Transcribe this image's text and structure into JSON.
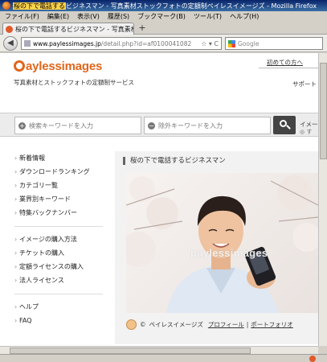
{
  "window": {
    "title_prefix": "桜の下で電話する",
    "title_rest": "ビジネスマン - 写真素材ストックフォトの定額制ペイレスイメージズ - Mozilla Firefox"
  },
  "menu": [
    "ファイル(F)",
    "編集(E)",
    "表示(V)",
    "履歴(S)",
    "ブックマーク(B)",
    "ツール(T)",
    "ヘルプ(H)"
  ],
  "tab": {
    "label": "桜の下で電話するビジネスマン - 写真素材ストックフ..."
  },
  "nav": {
    "url_domain": "www.paylessimages.jp",
    "url_path": "/detail.php?id=af0100041082",
    "search_placeholder": "Google",
    "url_icons": "☆ ▾ C"
  },
  "header": {
    "logo_text": "aylessimages",
    "tagline": "写真素材とストックフォトの定額制サービス",
    "first_time_link": "初めての方へ",
    "support_label": "サポート"
  },
  "search": {
    "keyword_placeholder": "検索キーワードを入力",
    "exclude_placeholder": "除外キーワードを入力",
    "image_search_label": "イメー",
    "image_search_sub": "◎ す"
  },
  "sidebar": {
    "group1": [
      "新着情報",
      "ダウンロードランキング",
      "カテゴリ一覧",
      "業界別キーワード",
      "特集バックナンバー"
    ],
    "group2": [
      "イメージの購入方法",
      "チケットの購入",
      "定額ライセンスの購入",
      "法人ライセンス"
    ],
    "group3": [
      "ヘルプ",
      "FAQ"
    ]
  },
  "content": {
    "title": "桜の下で電話するビジネスマン",
    "watermark": "paylessimages",
    "credit": {
      "copyright": "©",
      "author": "ペイレスイメージズ",
      "sep": "|",
      "profile_link": "プロフィール",
      "portfolio_link": "ポートフォリオ"
    }
  },
  "colors": {
    "brand": "#e0661b",
    "search_button": "#444444"
  }
}
